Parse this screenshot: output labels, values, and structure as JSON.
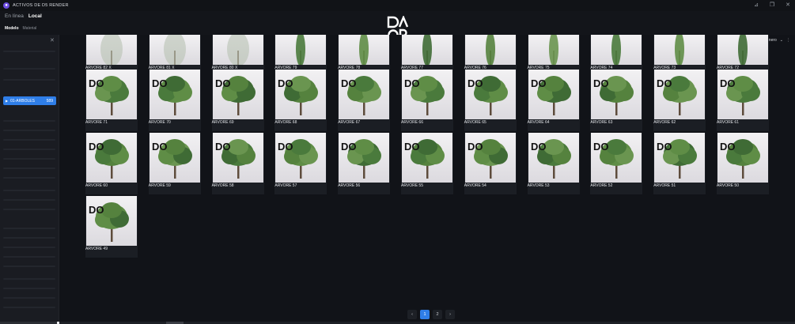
{
  "window": {
    "title": "ACTIVOS DE D5 RENDER",
    "controls": [
      "pin-icon",
      "restore-icon",
      "close-icon"
    ]
  },
  "header": {
    "source_tabs": [
      {
        "label": "En línea",
        "active": false
      },
      {
        "label": "Local",
        "active": true
      }
    ],
    "category_tabs": [
      {
        "label": "Modelo",
        "active": true
      },
      {
        "label": "Material",
        "active": false
      }
    ]
  },
  "sidebar": {
    "active_item": {
      "label": "01-ARBOLES",
      "count": "589"
    }
  },
  "toolbar": {
    "sort_label": "Lo más nuevo primero"
  },
  "assets": {
    "rows": [
      [
        "ARVORE 82 X",
        "ARVORE 81 X",
        "ARVORE 80 X",
        "ARVORE 79",
        "ARVORE 78",
        "ARVORE 77",
        "ARVORE 76",
        "ARVORE 75",
        "ARVORE 74",
        "ARVORE 73",
        "ARVORE 72"
      ],
      [
        "ARVORE 71",
        "ARVORE 70",
        "ARVORE 69",
        "ARVORE 68",
        "ARVORE 67",
        "ARVORE 66",
        "ARVORE 65",
        "ARVORE 64",
        "ARVORE 63",
        "ARVORE 62",
        "ARVORE 61"
      ],
      [
        "ARVORE 60",
        "ARVORE 59",
        "ARVORE 58",
        "ARVORE 57",
        "ARVORE 56",
        "ARVORE 55",
        "ARVORE 54",
        "ARVORE 53",
        "ARVORE 52",
        "ARVORE 51",
        "ARVORE 50"
      ],
      [
        "ARVORE 49"
      ]
    ]
  },
  "pagination": {
    "pages": [
      "1",
      "2"
    ],
    "current": "1",
    "prev_icon": "chevron-left-icon",
    "next_icon": "chevron-right-icon"
  },
  "colors": {
    "accent": "#2f7ee8",
    "background": "#111318"
  }
}
